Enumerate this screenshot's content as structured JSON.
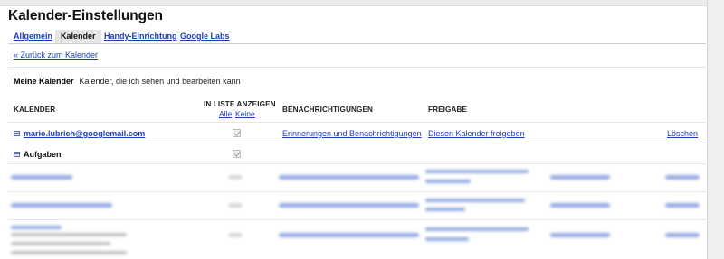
{
  "page": {
    "title": "Kalender-Einstellungen"
  },
  "tabs": [
    {
      "label": "Allgemein"
    },
    {
      "label": "Kalender"
    },
    {
      "label": "Handy-Einrichtung"
    },
    {
      "label": "Google Labs"
    }
  ],
  "back_link": "« Zurück zum Kalender",
  "section": {
    "heading": "Meine Kalender",
    "description": "Kalender, die ich sehen und bearbeiten kann"
  },
  "table": {
    "headers": {
      "kalender": "KALENDER",
      "in_liste": "IN LISTE ANZEIGEN",
      "alle": "Alle",
      "keine": "Keine",
      "benachrichtigungen": "BENACHRICHTIGUNGEN",
      "freigabe": "FREIGABE"
    },
    "rows": [
      {
        "name": "mario.lubrich@googlemail.com",
        "shown": true,
        "notifications": "Erinnerungen und Benachrichtigungen",
        "sharing": "Diesen Kalender freigeben",
        "delete": "Löschen"
      },
      {
        "name": "Aufgaben",
        "shown": true
      }
    ]
  }
}
